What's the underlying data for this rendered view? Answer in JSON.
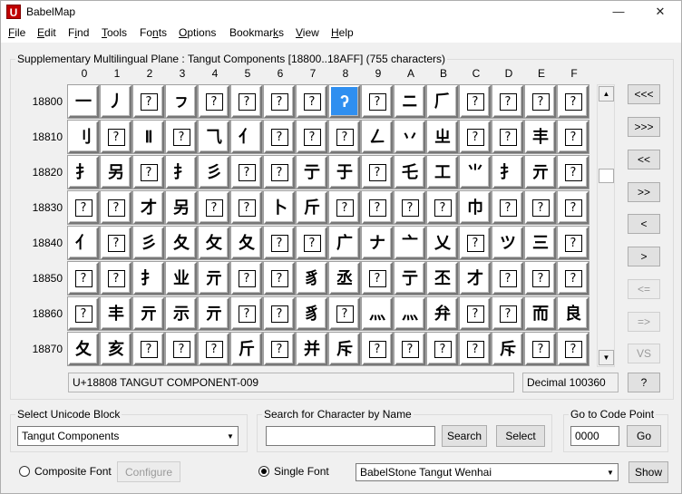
{
  "window": {
    "title": "BabelMap",
    "app_icon": "U",
    "controls": {
      "minimize": "—",
      "maximize": "☐",
      "close": "✕"
    }
  },
  "menu": [
    {
      "pre": "",
      "ul": "F",
      "post": "ile"
    },
    {
      "pre": "",
      "ul": "E",
      "post": "dit"
    },
    {
      "pre": "F",
      "ul": "i",
      "post": "nd"
    },
    {
      "pre": "",
      "ul": "T",
      "post": "ools"
    },
    {
      "pre": "Fo",
      "ul": "n",
      "post": "ts"
    },
    {
      "pre": "",
      "ul": "O",
      "post": "ptions"
    },
    {
      "pre": "Bookmar",
      "ul": "k",
      "post": "s"
    },
    {
      "pre": "",
      "ul": "V",
      "post": "iew"
    },
    {
      "pre": "",
      "ul": "H",
      "post": "elp"
    }
  ],
  "grid_panel": {
    "label": "Supplementary Multilingual Plane : Tangut Components [18800..18AFF] (755 characters)",
    "columns": [
      "0",
      "1",
      "2",
      "3",
      "4",
      "5",
      "6",
      "7",
      "8",
      "9",
      "A",
      "B",
      "C",
      "D",
      "E",
      "F"
    ],
    "rows": [
      {
        "label": "18800",
        "cells": [
          "一",
          "丿",
          "?",
          "ㇷ",
          "?",
          "?",
          "?",
          "?",
          "ʔ",
          "?",
          "ニ",
          "𠂆",
          "?",
          "?",
          "?",
          "?"
        ]
      },
      {
        "label": "18810",
        "cells": [
          "刂",
          "?",
          "Ⅱ",
          "?",
          "⺄",
          "亻",
          "?",
          "?",
          "?",
          "ㄥ",
          "丷",
          "ㄓ",
          "?",
          "?",
          "丰",
          "?"
        ]
      },
      {
        "label": "18820",
        "cells": [
          "⺘",
          "另",
          "?",
          "扌",
          "彡",
          "?",
          "?",
          "亍",
          "于",
          "?",
          "乇",
          "工",
          "⺌",
          "扌",
          "亓",
          "?"
        ]
      },
      {
        "label": "18830",
        "cells": [
          "?",
          "?",
          "才",
          "另",
          "?",
          "?",
          "卜",
          "斤",
          "?",
          "?",
          "?",
          "?",
          "巾",
          "?",
          "?",
          "?"
        ]
      },
      {
        "label": "18840",
        "cells": [
          "亻",
          "?",
          "彡",
          "夂",
          "攵",
          "夂",
          "?",
          "?",
          "广",
          "ナ",
          "亠",
          "乂",
          "?",
          "ツ",
          "三",
          "?"
        ]
      },
      {
        "label": "18850",
        "cells": [
          "?",
          "?",
          "⺘",
          "业",
          "亓",
          "?",
          "?",
          "豸",
          "丞",
          "?",
          "亍",
          "丕",
          "才",
          "?",
          "?",
          "?"
        ]
      },
      {
        "label": "18860",
        "cells": [
          "?",
          "丰",
          "亓",
          "示",
          "亓",
          "?",
          "?",
          "豸",
          "?",
          "灬",
          "灬",
          "弁",
          "?",
          "?",
          "而",
          "良"
        ]
      },
      {
        "label": "18870",
        "cells": [
          "夂",
          "亥",
          "?",
          "?",
          "?",
          "斤",
          "?",
          "并",
          "斥",
          "?",
          "?",
          "?",
          "?",
          "斥",
          "?",
          "?"
        ]
      }
    ],
    "selected": {
      "row": 0,
      "col": 8
    },
    "status_name": "U+18808 TANGUT COMPONENT-009",
    "status_decimal": "Decimal 100360"
  },
  "side_buttons": [
    "<<<",
    ">>>",
    "<<",
    ">>",
    "<",
    ">",
    "<=",
    "=>",
    "VS",
    "?"
  ],
  "block_group": {
    "label": "Select Unicode Block",
    "value": "Tangut Components"
  },
  "search_group": {
    "label": "Search for Character by Name",
    "value": "",
    "search_btn": "Search",
    "select_btn": "Select"
  },
  "goto_group": {
    "label": "Go to Code Point",
    "value": "0000",
    "go_btn": "Go"
  },
  "bottom": {
    "composite_label": "Composite Font",
    "configure_btn": "Configure",
    "single_label": "Single Font",
    "font_value": "BabelStone Tangut Wenhai",
    "show_btn": "Show"
  },
  "colors": {
    "selected_cell": "#2f8ff0",
    "app_icon_red": "#c00000"
  }
}
